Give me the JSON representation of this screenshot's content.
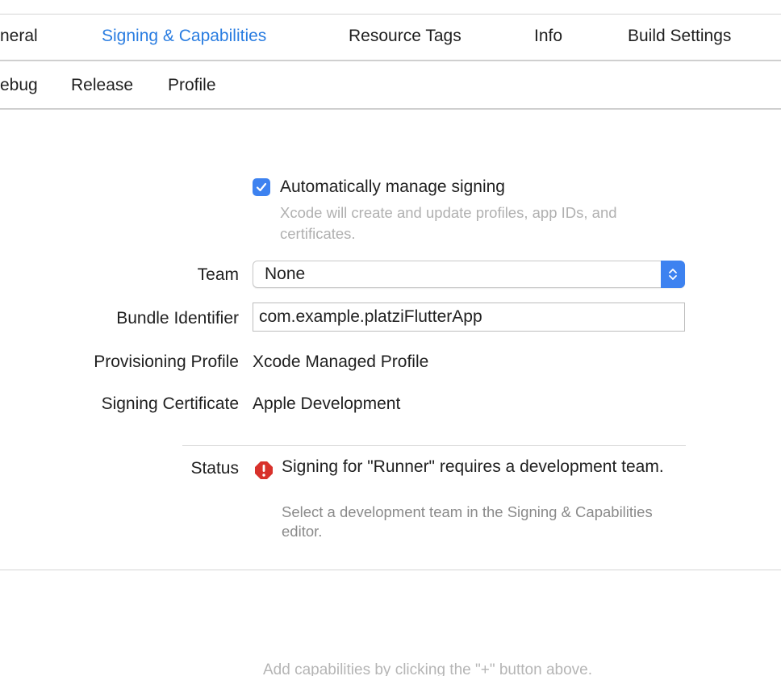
{
  "tabs": [
    {
      "label": "neral",
      "active": false
    },
    {
      "label": "Signing & Capabilities",
      "active": true
    },
    {
      "label": "Resource Tags",
      "active": false
    },
    {
      "label": "Info",
      "active": false
    },
    {
      "label": "Build Settings",
      "active": false
    }
  ],
  "configs": [
    {
      "label": "ebug"
    },
    {
      "label": "Release"
    },
    {
      "label": "Profile"
    }
  ],
  "signing": {
    "auto_manage_checked": true,
    "auto_manage_label": "Automatically manage signing",
    "auto_manage_hint": "Xcode will create and update profiles, app IDs, and certificates.",
    "team_label": "Team",
    "team_value": "None",
    "bundle_id_label": "Bundle Identifier",
    "bundle_id_value": "com.example.platziFlutterApp",
    "provisioning_profile_label": "Provisioning Profile",
    "provisioning_profile_value": "Xcode Managed Profile",
    "signing_certificate_label": "Signing Certificate",
    "signing_certificate_value": "Apple Development",
    "status_label": "Status",
    "status_message": "Signing for \"Runner\" requires a development team.",
    "status_hint": "Select a development team in the Signing & Capabilities editor."
  },
  "capabilities_hint": "Add capabilities by clicking the \"+\" button above.",
  "colors": {
    "accent": "#2a7de1",
    "checkbox": "#3d82f0",
    "error": "#d8312b"
  }
}
